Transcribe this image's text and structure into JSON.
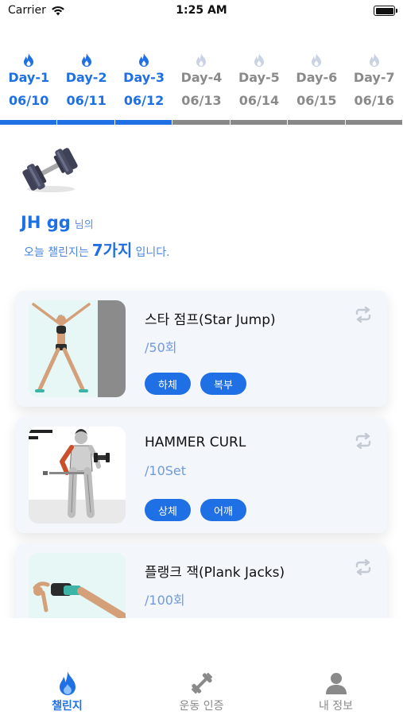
{
  "status_bar": {
    "carrier": "Carrier",
    "time": "1:25 AM"
  },
  "days": [
    {
      "label": "Day-1",
      "date": "06/10",
      "completed": true
    },
    {
      "label": "Day-2",
      "date": "06/11",
      "completed": true
    },
    {
      "label": "Day-3",
      "date": "06/12",
      "completed": true
    },
    {
      "label": "Day-4",
      "date": "06/13",
      "completed": false
    },
    {
      "label": "Day-5",
      "date": "06/14",
      "completed": false
    },
    {
      "label": "Day-6",
      "date": "06/15",
      "completed": false
    },
    {
      "label": "Day-7",
      "date": "06/16",
      "completed": false
    }
  ],
  "profile": {
    "name": "JH gg",
    "name_suffix": "님의",
    "challenge_prefix": "오늘 챌린지는",
    "challenge_count": "7가지",
    "challenge_suffix": "입니다."
  },
  "exercises": [
    {
      "title": "스타 점프(Star Jump)",
      "amount": "/50회",
      "tags": [
        "하체",
        "복부"
      ],
      "icon": "star-jump-illustration"
    },
    {
      "title": "HAMMER CURL",
      "amount": "/10Set",
      "tags": [
        "상체",
        "어깨"
      ],
      "icon": "hammer-curl-illustration"
    },
    {
      "title": "플랭크 잭(Plank Jacks)",
      "amount": "/100회",
      "tags": [],
      "icon": "plank-jacks-illustration"
    }
  ],
  "tab_bar": {
    "items": [
      {
        "label": "챌린지",
        "icon": "flame-icon",
        "active": true
      },
      {
        "label": "운동 인증",
        "icon": "dumbbell-icon",
        "active": false
      },
      {
        "label": "내 정보",
        "icon": "person-icon",
        "active": false
      }
    ]
  },
  "colors": {
    "accent": "#1f6fe5",
    "inactive": "#8a8a8a",
    "card_bg": "#f3f6fb"
  }
}
